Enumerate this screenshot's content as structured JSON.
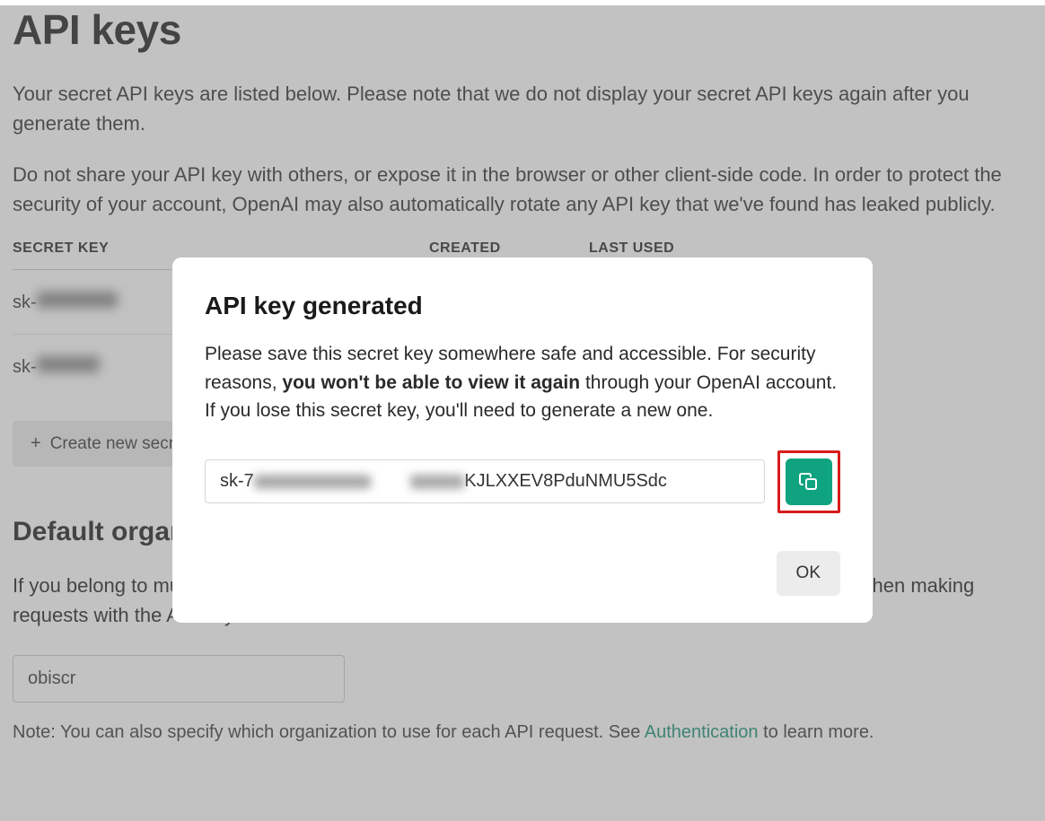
{
  "page": {
    "title": "API keys",
    "intro1": "Your secret API keys are listed below. Please note that we do not display your secret API keys again after you generate them.",
    "intro2": "Do not share your API key with others, or expose it in the browser or other client-side code. In order to protect the security of your account, OpenAI may also automatically rotate any API key that we've found has leaked publicly."
  },
  "table": {
    "headers": {
      "key": "SECRET KEY",
      "created": "CREATED",
      "used": "LAST USED"
    },
    "rows": [
      {
        "key_prefix": "sk-"
      },
      {
        "key_prefix": "sk-"
      }
    ]
  },
  "create_button": "Create new secret key",
  "org": {
    "title": "Default organization",
    "desc": "If you belong to multiple organizations, this setting controls which organization is used by default when making requests with the API keys above.",
    "value": "obiscr",
    "note_pre": "Note: You can also specify which organization to use for each API request. See ",
    "note_link": "Authentication",
    "note_post": " to learn more."
  },
  "modal": {
    "title": "API key generated",
    "text_pre": "Please save this secret key somewhere safe and accessible. For security reasons, ",
    "text_bold": "you won't be able to view it again",
    "text_post": " through your OpenAI account. If you lose this secret key, you'll need to generate a new one.",
    "key_prefix": "sk-7",
    "key_suffix": "KJLXXEV8PduNMU5Sdc",
    "ok": "OK"
  }
}
